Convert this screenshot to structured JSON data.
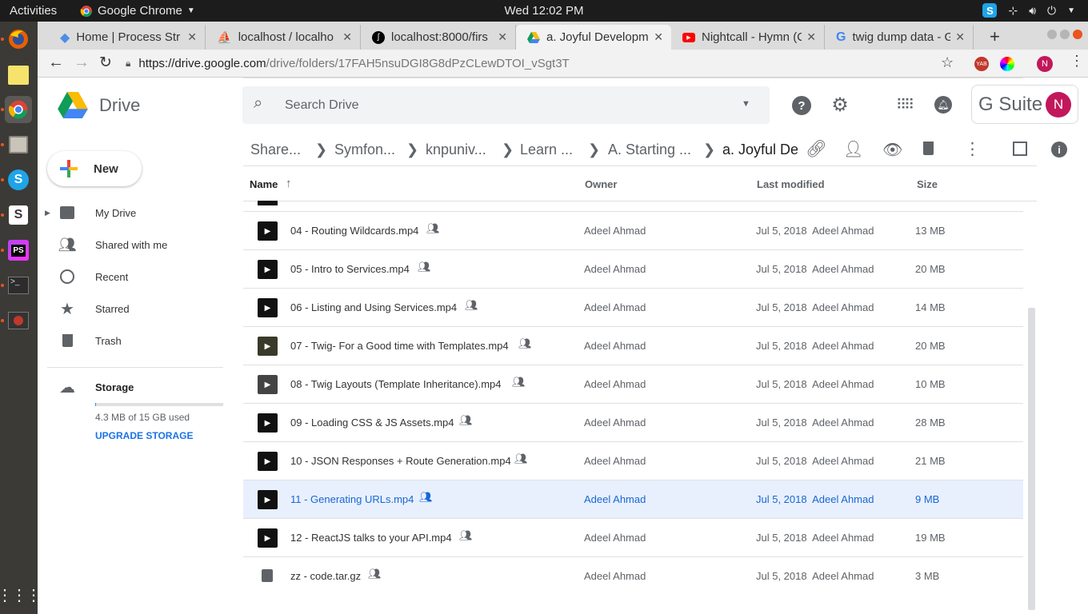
{
  "os": {
    "activities": "Activities",
    "app_name": "Google Chrome",
    "clock": "Wed 12:02 PM"
  },
  "tabs": [
    {
      "title": "Home | Process Str",
      "icon": "process-street-icon"
    },
    {
      "title": "localhost / localho",
      "icon": "phpmyadmin-icon"
    },
    {
      "title": "localhost:8000/firs",
      "icon": "symfony-icon"
    },
    {
      "title": "a. Joyful Developm",
      "icon": "drive-icon"
    },
    {
      "title": "Nightcall - Hymn (C",
      "icon": "youtube-icon"
    },
    {
      "title": "twig dump data - G",
      "icon": "google-icon"
    }
  ],
  "address": {
    "url_host": "https://drive.google.com",
    "url_path": "/drive/folders/17FAH5nsuDGI8G8dPzCLewDTOI_vSgt3T",
    "avatar_letter": "N"
  },
  "header": {
    "brand": "Drive",
    "search_placeholder": "Search Drive",
    "gsuite": "G Suite",
    "avatar": "N"
  },
  "sidebar": {
    "new_label": "New",
    "items": [
      {
        "label": "My Drive"
      },
      {
        "label": "Shared with me"
      },
      {
        "label": "Recent"
      },
      {
        "label": "Starred"
      },
      {
        "label": "Trash"
      }
    ],
    "storage_label": "Storage",
    "storage_used": "4.3 MB of 15 GB used",
    "storage_fraction": 0.0003,
    "upgrade": "UPGRADE STORAGE"
  },
  "breadcrumb": [
    "Share...",
    "Symfon...",
    "knpuniv...",
    "Learn ...",
    "A. Starting ...",
    "a. Joyful De"
  ],
  "columns": {
    "name": "Name",
    "owner": "Owner",
    "modified": "Last modified",
    "size": "Size"
  },
  "files": [
    {
      "name": "04 - Routing Wildcards.mp4",
      "owner": "Adeel Ahmad",
      "date": "Jul 5, 2018",
      "by": "Adeel Ahmad",
      "size": "13 MB",
      "kind": "video"
    },
    {
      "name": "05 - Intro to Services.mp4",
      "owner": "Adeel Ahmad",
      "date": "Jul 5, 2018",
      "by": "Adeel Ahmad",
      "size": "20 MB",
      "kind": "video"
    },
    {
      "name": "06 - Listing and Using Services.mp4",
      "owner": "Adeel Ahmad",
      "date": "Jul 5, 2018",
      "by": "Adeel Ahmad",
      "size": "14 MB",
      "kind": "video"
    },
    {
      "name": "07 - Twig- For a Good time with Templates.mp4",
      "owner": "Adeel Ahmad",
      "date": "Jul 5, 2018",
      "by": "Adeel Ahmad",
      "size": "20 MB",
      "kind": "video"
    },
    {
      "name": "08 - Twig Layouts (Template Inheritance).mp4",
      "owner": "Adeel Ahmad",
      "date": "Jul 5, 2018",
      "by": "Adeel Ahmad",
      "size": "10 MB",
      "kind": "video"
    },
    {
      "name": "09 - Loading CSS & JS Assets.mp4",
      "owner": "Adeel Ahmad",
      "date": "Jul 5, 2018",
      "by": "Adeel Ahmad",
      "size": "28 MB",
      "kind": "video"
    },
    {
      "name": "10 - JSON Responses + Route Generation.mp4",
      "owner": "Adeel Ahmad",
      "date": "Jul 5, 2018",
      "by": "Adeel Ahmad",
      "size": "21 MB",
      "kind": "video"
    },
    {
      "name": "11 - Generating URLs.mp4",
      "owner": "Adeel Ahmad",
      "date": "Jul 5, 2018",
      "by": "Adeel Ahmad",
      "size": "9 MB",
      "kind": "video",
      "selected": true
    },
    {
      "name": "12 - ReactJS talks to your API.mp4",
      "owner": "Adeel Ahmad",
      "date": "Jul 5, 2018",
      "by": "Adeel Ahmad",
      "size": "19 MB",
      "kind": "video"
    },
    {
      "name": "zz - code.tar.gz",
      "owner": "Adeel Ahmad",
      "date": "Jul 5, 2018",
      "by": "Adeel Ahmad",
      "size": "3 MB",
      "kind": "archive"
    }
  ]
}
